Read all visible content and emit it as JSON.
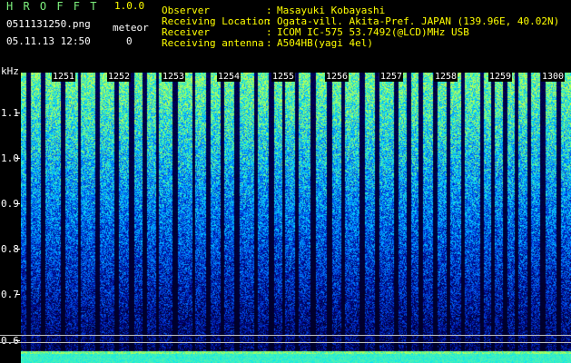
{
  "header": {
    "app_title": "H R O F F T",
    "version": "1.0.0",
    "file_name": "0511131250.png",
    "date_time": "05.11.13 12:50",
    "meteor_label": "meteor",
    "meteor_count": "0"
  },
  "info": {
    "labels": "Observer\nReceiving Location\nReceiver\nReceiving antenna",
    "colons": ":\n:\n:\n:",
    "values": "Masayuki Kobayashi\nOgata-vill. Akita-Pref. JAPAN (139.96E, 40.02N)\nICOM IC-575 53.7492(@LCD)MHz USB\nA504HB(yagi 4el)"
  },
  "spectrum": {
    "unit": "kHz",
    "y_ticks": [
      "1.1",
      "1.0",
      "0.9",
      "0.8",
      "0.7",
      "0.6"
    ],
    "time_labels": [
      "1251",
      "1252",
      "1253",
      "1254",
      "1255",
      "1256",
      "1257",
      "1258",
      "1259",
      "1300"
    ],
    "colors": {
      "low": "#000040",
      "mid": "#0050ff",
      "high": "#00e0ff",
      "top": "#a0ff40"
    }
  }
}
